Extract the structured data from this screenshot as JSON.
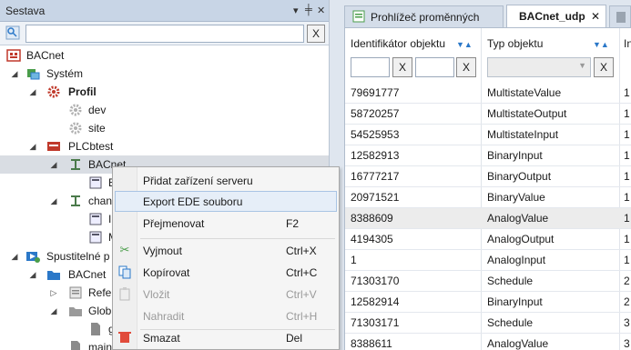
{
  "left_panel": {
    "title": "Sestava",
    "header_icons": [
      "▾",
      "╪",
      "✕"
    ],
    "filter": {
      "value": "",
      "clear_label": "X"
    },
    "tree": [
      {
        "label": "BACnet",
        "icon": "bacnet-root-icon",
        "bold": false
      },
      {
        "label": "Systém",
        "icon": "system-icon"
      },
      {
        "label": "Profil",
        "icon": "profile-gear-icon",
        "bold": true
      },
      {
        "label": "dev",
        "icon": "gear-icon"
      },
      {
        "label": "site",
        "icon": "gear-icon"
      },
      {
        "label": "PLCbtest",
        "icon": "plc-icon"
      },
      {
        "label": "BACnet",
        "icon": "device-icon"
      },
      {
        "label": "B",
        "icon": "object-icon"
      },
      {
        "label": "chan",
        "icon": "device-icon"
      },
      {
        "label": "I",
        "icon": "object-icon"
      },
      {
        "label": "M",
        "icon": "object-icon"
      },
      {
        "label": "Spustitelné p",
        "icon": "runnable-icon"
      },
      {
        "label": "BACnet",
        "icon": "folder-blue-icon"
      },
      {
        "label": "Refer",
        "icon": "reference-icon"
      },
      {
        "label": "Glob",
        "icon": "folder-gray-icon"
      },
      {
        "label": "g",
        "icon": "file-icon"
      },
      {
        "label": "main",
        "icon": "file-icon"
      }
    ]
  },
  "context_menu": {
    "items": [
      {
        "label": "Přidat zařízení serveru",
        "shortcut": "",
        "icon": ""
      },
      {
        "label": "Export EDE souboru",
        "shortcut": "",
        "icon": ""
      },
      {
        "label": "Přejmenovat",
        "shortcut": "F2",
        "icon": ""
      },
      {
        "label": "Vyjmout",
        "shortcut": "Ctrl+X",
        "icon": "cut-icon"
      },
      {
        "label": "Kopírovat",
        "shortcut": "Ctrl+C",
        "icon": "copy-icon"
      },
      {
        "label": "Vložit",
        "shortcut": "Ctrl+V",
        "icon": "paste-icon"
      },
      {
        "label": "Nahradit",
        "shortcut": "Ctrl+H",
        "icon": ""
      },
      {
        "label": "Smazat",
        "shortcut": "Del",
        "icon": "delete-icon"
      }
    ]
  },
  "tabs": [
    {
      "label": "Prohlížeč proměnných",
      "icon": "variable-browser-icon"
    },
    {
      "label": "BACnet_udp",
      "close": "✕"
    }
  ],
  "grid": {
    "columns": [
      "Identifikátor objektu",
      "Typ objektu",
      "In"
    ],
    "filter_clear_label": "X",
    "rows": [
      {
        "id": "79691777",
        "type": "MultistateValue",
        "c3": "1"
      },
      {
        "id": "58720257",
        "type": "MultistateOutput",
        "c3": "1"
      },
      {
        "id": "54525953",
        "type": "MultistateInput",
        "c3": "1"
      },
      {
        "id": "12582913",
        "type": "BinaryInput",
        "c3": "1"
      },
      {
        "id": "16777217",
        "type": "BinaryOutput",
        "c3": "1"
      },
      {
        "id": "20971521",
        "type": "BinaryValue",
        "c3": "1"
      },
      {
        "id": "8388609",
        "type": "AnalogValue",
        "c3": "1"
      },
      {
        "id": "4194305",
        "type": "AnalogOutput",
        "c3": "1"
      },
      {
        "id": "1",
        "type": "AnalogInput",
        "c3": "1"
      },
      {
        "id": "71303170",
        "type": "Schedule",
        "c3": "2"
      },
      {
        "id": "12582914",
        "type": "BinaryInput",
        "c3": "2"
      },
      {
        "id": "71303171",
        "type": "Schedule",
        "c3": "3"
      },
      {
        "id": "8388611",
        "type": "AnalogValue",
        "c3": "3"
      }
    ]
  },
  "colors": {
    "accent": "#2b78c8",
    "header_bg": "#c8d5e6",
    "selection": "#d9dde3"
  }
}
